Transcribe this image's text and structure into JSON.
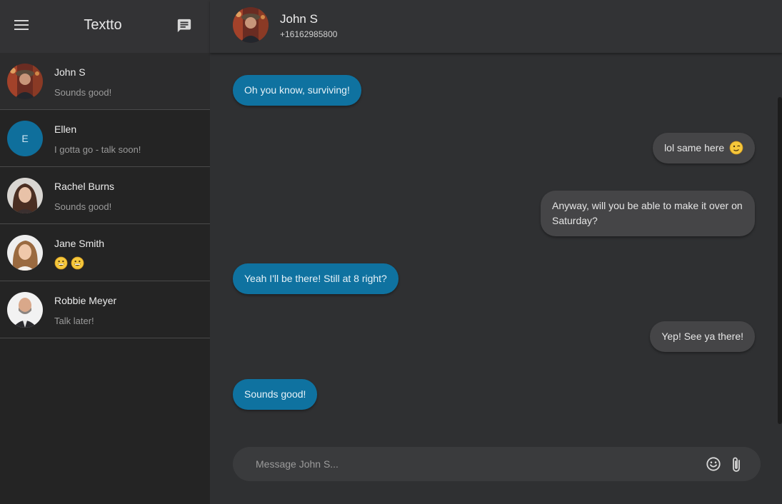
{
  "app": {
    "title": "Textto"
  },
  "conversations": [
    {
      "name": "John S",
      "preview": "Sounds good!",
      "active": true
    },
    {
      "name": "Ellen",
      "initial": "E",
      "preview": "I gotta go - talk soon!"
    },
    {
      "name": "Rachel Burns",
      "preview": "Sounds good!"
    },
    {
      "name": "Jane Smith",
      "preview_icons": [
        "grinning-face-icon",
        "grinning-face-icon"
      ]
    },
    {
      "name": "Robbie Meyer",
      "preview": "Talk later!"
    }
  ],
  "chat": {
    "contact_name": "John S",
    "contact_phone": "+16162985800",
    "messages": [
      {
        "direction": "in",
        "text": "Oh you know, surviving!"
      },
      {
        "direction": "out",
        "text": "lol same here",
        "icon": "winking-face-icon"
      },
      {
        "direction": "out",
        "text": "Anyway, will you be able to make it over on Saturday?"
      },
      {
        "direction": "in",
        "text": "Yeah I'll be there! Still at 8 right?"
      },
      {
        "direction": "out",
        "text": "Yep! See ya there!"
      },
      {
        "direction": "in",
        "text": "Sounds good!"
      }
    ],
    "composer_placeholder": "Message John S..."
  },
  "colors": {
    "incoming_bubble": "#0f72a0",
    "outgoing_bubble": "#454547",
    "sidebar": "#242424",
    "accent": "#0f6f9c"
  }
}
